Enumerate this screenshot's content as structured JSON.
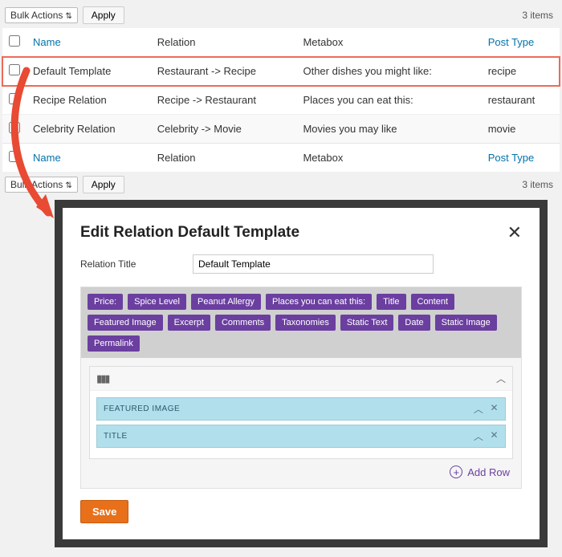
{
  "toolbar": {
    "bulk_label": "Bulk Actions",
    "apply_label": "Apply",
    "item_count": "3 items"
  },
  "columns": {
    "name": "Name",
    "relation": "Relation",
    "metabox": "Metabox",
    "post_type": "Post Type"
  },
  "rows": [
    {
      "name": "Default Template",
      "relation": "Restaurant -> Recipe",
      "metabox": "Other dishes you might like:",
      "post_type": "recipe",
      "highlight": true
    },
    {
      "name": "Recipe Relation",
      "relation": "Recipe -> Restaurant",
      "metabox": "Places you can eat this:",
      "post_type": "restaurant"
    },
    {
      "name": "Celebrity Relation",
      "relation": "Celebrity -> Movie",
      "metabox": "Movies you may like",
      "post_type": "movie"
    }
  ],
  "modal": {
    "title": "Edit Relation Default Template",
    "field_label": "Relation Title",
    "field_value": "Default Template",
    "tags": [
      "Price:",
      "Spice Level",
      "Peanut Allergy",
      "Places you can eat this:",
      "Title",
      "Content",
      "Featured Image",
      "Excerpt",
      "Comments",
      "Taxonomies",
      "Static Text",
      "Date",
      "Static Image",
      "Permalink"
    ],
    "items": [
      "FEATURED IMAGE",
      "TITLE"
    ],
    "add_row": "Add Row",
    "save": "Save"
  }
}
